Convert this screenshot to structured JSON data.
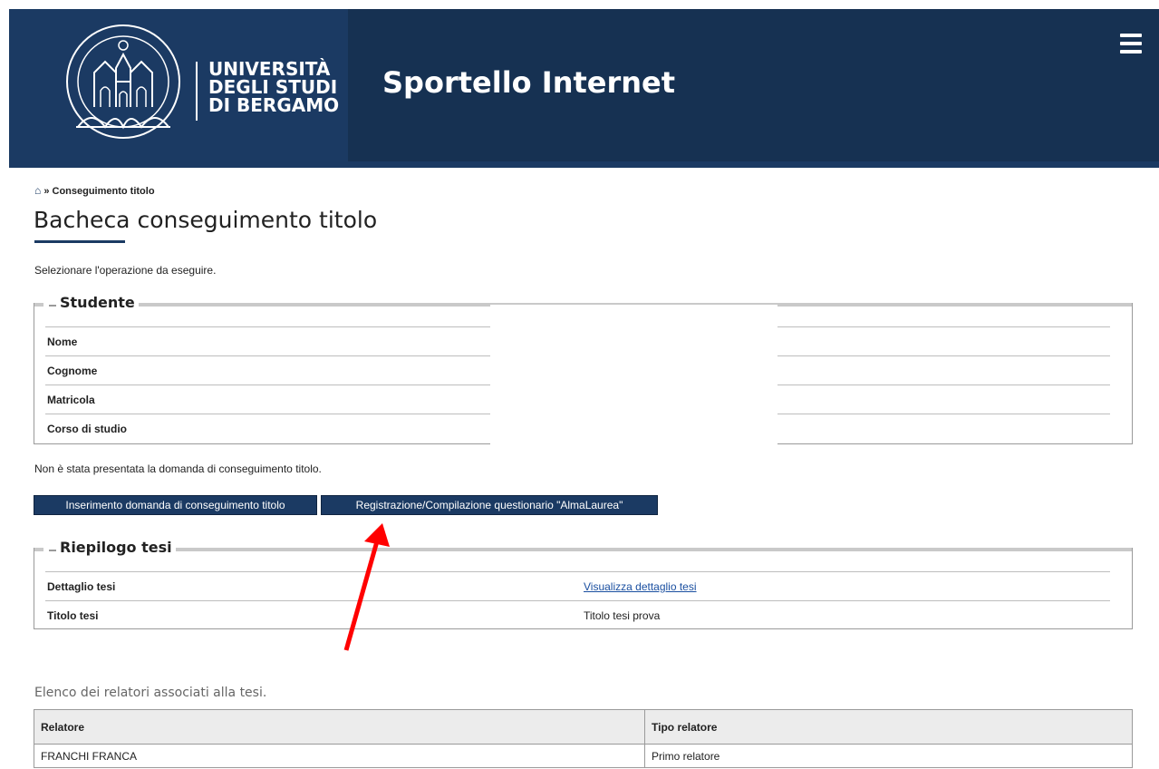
{
  "header": {
    "university_lines": [
      "UNIVERSITÀ",
      "DEGLI STUDI",
      "DI BERGAMO"
    ],
    "app_title": "Sportello Internet",
    "menu_icon": "hamburger-menu-icon",
    "bg_color": "#1b3a63"
  },
  "breadcrumb": {
    "home_icon": "home-icon",
    "separator": "»",
    "current": "Conseguimento titolo"
  },
  "page": {
    "title": "Bacheca conseguimento titolo",
    "intro": "Selezionare l'operazione da eseguire."
  },
  "student": {
    "legend": "Studente",
    "rows": [
      {
        "label": "Nome",
        "value": ""
      },
      {
        "label": "Cognome",
        "value": ""
      },
      {
        "label": "Matricola",
        "value": ""
      },
      {
        "label": "Corso di studio",
        "value": ""
      }
    ]
  },
  "notice": "Non è stata presentata la domanda di conseguimento titolo.",
  "buttons": {
    "insert_label": "Inserimento domanda di conseguimento titolo",
    "almalaurea_label": "Registrazione/Compilazione questionario \"AlmaLaurea\""
  },
  "thesis": {
    "legend": "Riepilogo tesi",
    "rows": [
      {
        "label": "Dettaglio tesi",
        "value": "Visualizza dettaglio tesi"
      },
      {
        "label": "Titolo tesi",
        "value": "Titolo tesi prova"
      }
    ]
  },
  "relatori": {
    "caption": "Elenco dei relatori associati alla tesi.",
    "headers": [
      "Relatore",
      "Tipo relatore"
    ],
    "rows": [
      [
        "FRANCHI FRANCA",
        "Primo relatore"
      ]
    ]
  },
  "colors": {
    "primary": "#1b3a63",
    "link": "#1a4fa0",
    "annotation_arrow": "#ff0000"
  }
}
